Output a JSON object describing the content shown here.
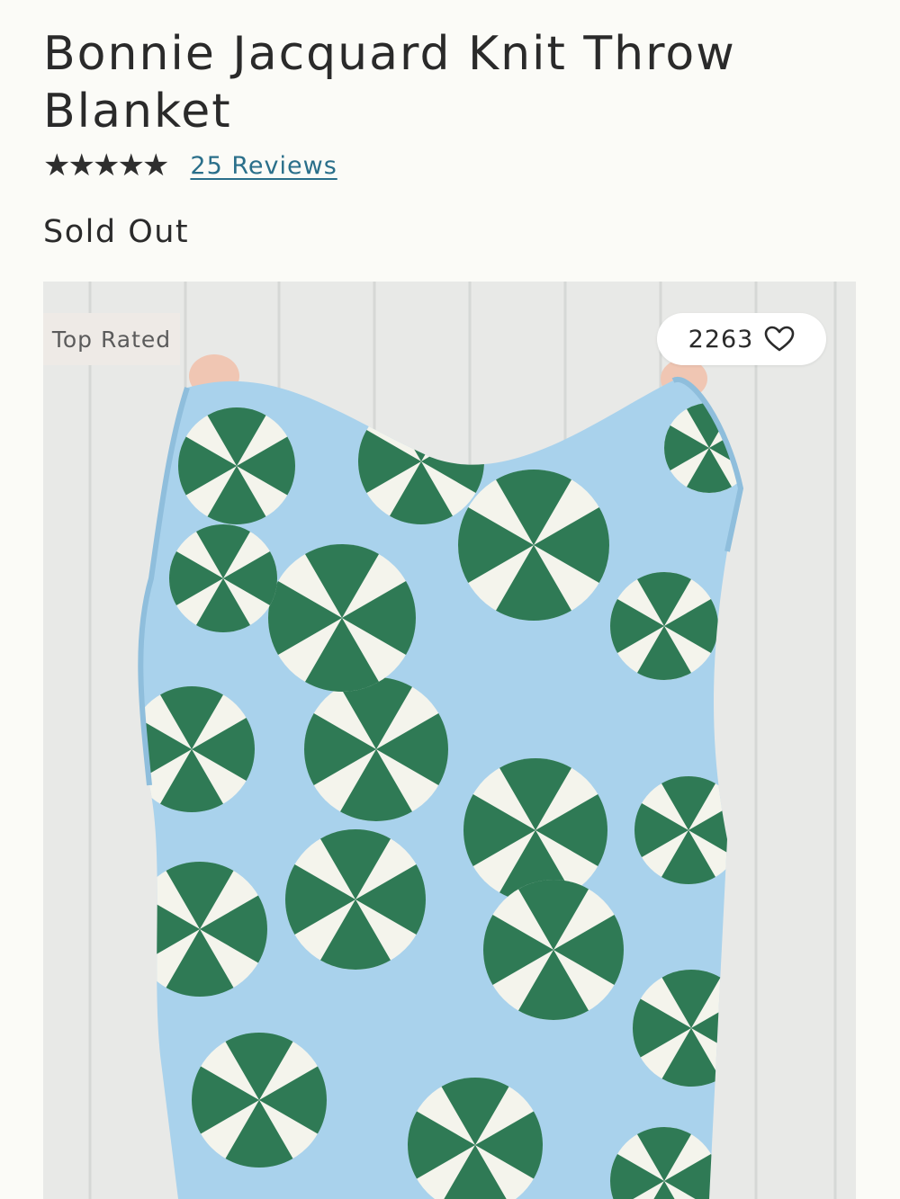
{
  "product": {
    "title": "Bonnie Jacquard Knit Throw Blanket",
    "rating": 5,
    "stars": [
      "★",
      "★",
      "★",
      "★",
      "★"
    ],
    "reviews_label": "25 Reviews",
    "availability": "Sold Out"
  },
  "image": {
    "badge_label": "Top Rated",
    "wishlist_count": "2263",
    "icon": "heart-outline-icon",
    "colors": {
      "blanket": "#a9d2ec",
      "pinwheel_green": "#2f7a55",
      "pinwheel_cream": "#f4f4ec",
      "wall": "#e7e8e6"
    }
  }
}
